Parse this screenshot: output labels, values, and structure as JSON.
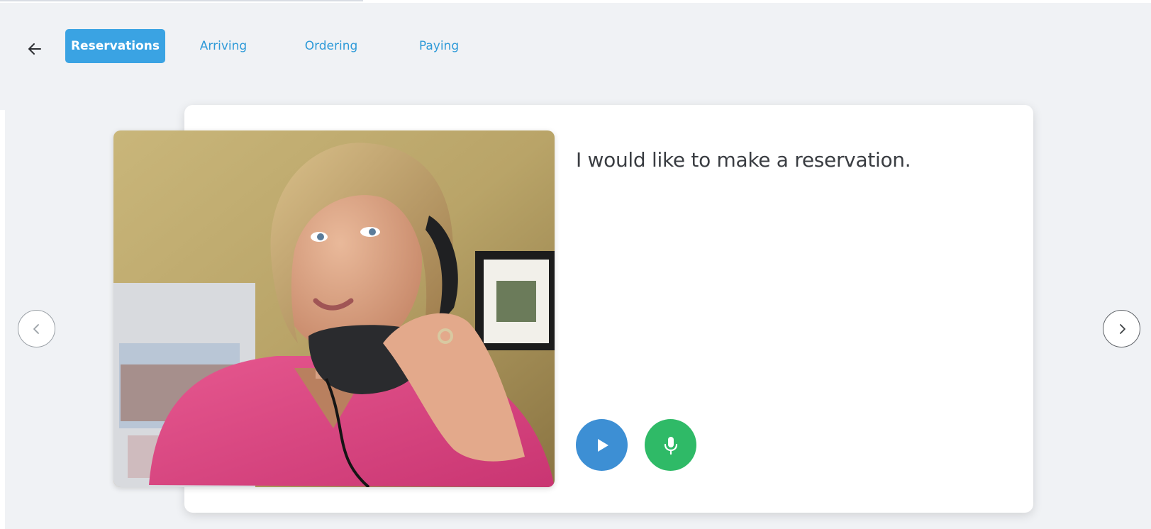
{
  "tabs": [
    {
      "label": "Reservations",
      "active": true
    },
    {
      "label": "Arriving",
      "active": false
    },
    {
      "label": "Ordering",
      "active": false
    },
    {
      "label": "Paying",
      "active": false
    }
  ],
  "card": {
    "phrase": "I would like to make a reservation."
  },
  "icons": {
    "back": "arrow-left-icon",
    "play": "play-icon",
    "mic": "microphone-icon",
    "prev": "chevron-left-icon",
    "next": "chevron-right-icon"
  },
  "colors": {
    "background": "#f0f2f5",
    "tab_active_bg": "#3aa3e3",
    "tab_text": "#2e9ad8",
    "play_button": "#3d8fd4",
    "mic_button": "#2fba67",
    "phrase_text": "#3a3d42"
  }
}
